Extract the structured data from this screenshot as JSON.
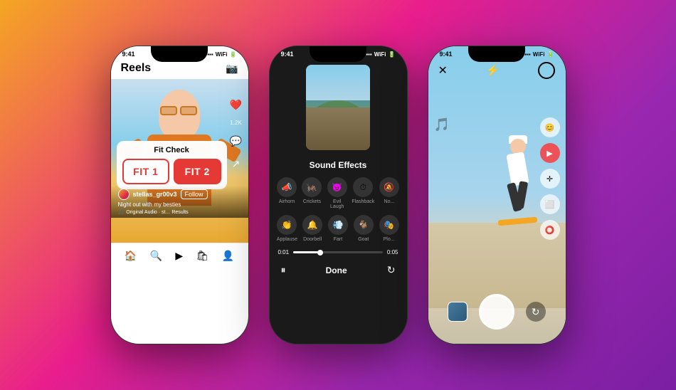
{
  "background": {
    "gradient_start": "#f5a623",
    "gradient_mid": "#e91e8c",
    "gradient_end": "#7b1fa2"
  },
  "phones": {
    "phone1": {
      "time": "9:41",
      "title": "Reels",
      "fit_check_label": "Fit Check",
      "fit_btn_1": "FIT 1",
      "fit_btn_2": "FIT 2",
      "username": "stellas_gr00v3",
      "follow_label": "Follow",
      "caption": "Night out with my besties",
      "audio_label": "Original Audio · st...",
      "results_label": "Results",
      "like_count": "1.2K",
      "nav_items": [
        "home",
        "search",
        "reels",
        "shop",
        "profile"
      ]
    },
    "phone2": {
      "time": "9:41",
      "title": "Sound Effects",
      "sound_items": [
        {
          "emoji": "📣",
          "label": "Airhorn"
        },
        {
          "emoji": "🦗",
          "label": "Crickets"
        },
        {
          "emoji": "😈",
          "label": "Evil Laugh"
        },
        {
          "emoji": "⏱",
          "label": "Flashback"
        },
        {
          "emoji": "🔔",
          "label": "No..."
        }
      ],
      "sound_items_row2": [
        {
          "emoji": "👏",
          "label": "Applause"
        },
        {
          "emoji": "🔔",
          "label": "Doorbell"
        },
        {
          "emoji": "💨",
          "label": "Fart"
        },
        {
          "emoji": "🐐",
          "label": "Goat"
        },
        {
          "emoji": "🎭",
          "label": "Plo..."
        }
      ],
      "time_start": "0:01",
      "time_end": "0:05",
      "done_label": "Done"
    },
    "phone3": {
      "time": "9:41",
      "tools": [
        "music",
        "emoji1",
        "emoji2",
        "move",
        "square",
        "circle"
      ],
      "close_icon": "✕",
      "circle_icon": "○"
    }
  }
}
